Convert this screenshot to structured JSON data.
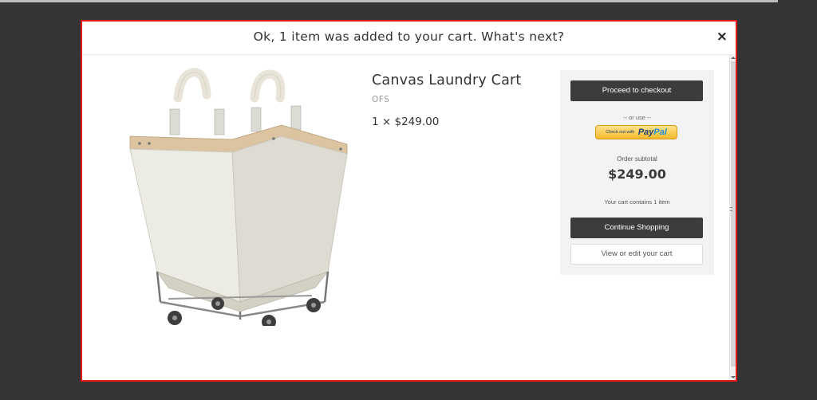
{
  "modal": {
    "title": "Ok, 1 item was added to your cart. What's next?",
    "close_label": "×"
  },
  "product": {
    "name": "Canvas Laundry Cart",
    "vendor": "OFS",
    "qty_price": "1 × $249.00",
    "image_icon": "laundry-cart-image"
  },
  "cart": {
    "checkout_label": "Proceed to checkout",
    "or_use": "-- or use --",
    "paypal_prefix": "Check out with",
    "paypal_pay": "Pay",
    "paypal_pal": "Pal",
    "subtotal_label": "Order subtotal",
    "subtotal_value": "$249.00",
    "count_text": "Your cart contains 1 item",
    "continue_label": "Continue Shopping",
    "view_edit_label": "View or edit your cart"
  },
  "colors": {
    "overlay": "#343434",
    "modal_border": "#e01b1b",
    "dark_button": "#3c3c3c",
    "panel_bg": "#f3f3f3",
    "paypal_yellow": "#f5b92b"
  }
}
